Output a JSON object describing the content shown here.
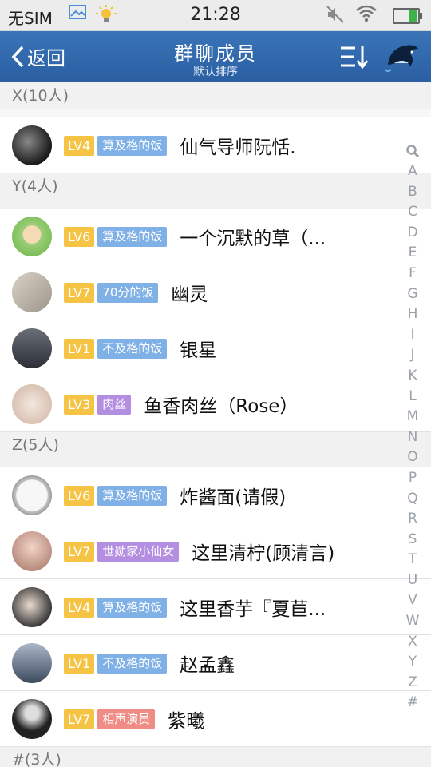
{
  "status_bar": {
    "carrier": "无SIM",
    "time": "21:28"
  },
  "nav": {
    "back_label": "返回",
    "title": "群聊成员",
    "subtitle": "默认排序"
  },
  "sections": [
    {
      "header": "X(10人)",
      "members": [
        {
          "level": "LV4",
          "tag": "算及格的饭",
          "tag_color": "#7fb0e6",
          "name": "仙气导师阮恬."
        }
      ]
    },
    {
      "header": "Y(4人)",
      "members": [
        {
          "level": "LV6",
          "tag": "算及格的饭",
          "tag_color": "#7fb0e6",
          "name": "一个沉默的草（..."
        },
        {
          "level": "LV7",
          "tag": "70分的饭",
          "tag_color": "#7fb0e6",
          "name": "幽灵"
        },
        {
          "level": "LV1",
          "tag": "不及格的饭",
          "tag_color": "#7fb0e6",
          "name": "银星"
        },
        {
          "level": "LV3",
          "tag": "肉丝",
          "tag_color": "#b48ee0",
          "name": "鱼香肉丝（Rose）"
        }
      ]
    },
    {
      "header": "Z(5人)",
      "members": [
        {
          "level": "LV6",
          "tag": "算及格的饭",
          "tag_color": "#7fb0e6",
          "name": "炸酱面(请假)"
        },
        {
          "level": "LV7",
          "tag": "世勋家小仙女",
          "tag_color": "#b48ee0",
          "name": "这里清柠(顾清言)"
        },
        {
          "level": "LV4",
          "tag": "算及格的饭",
          "tag_color": "#7fb0e6",
          "name": "这里香芋『夏苣..."
        },
        {
          "level": "LV1",
          "tag": "不及格的饭",
          "tag_color": "#7fb0e6",
          "name": "赵孟鑫"
        },
        {
          "level": "LV7",
          "tag": "相声演员",
          "tag_color": "#f08c86",
          "name": "紫曦"
        }
      ]
    },
    {
      "header": "#(3人)",
      "members": []
    }
  ],
  "index_letters": [
    "A",
    "B",
    "C",
    "D",
    "E",
    "F",
    "G",
    "H",
    "I",
    "J",
    "K",
    "L",
    "M",
    "N",
    "O",
    "P",
    "Q",
    "R",
    "S",
    "T",
    "U",
    "V",
    "W",
    "X",
    "Y",
    "Z",
    "#"
  ],
  "colors": {
    "nav_bg": "#2f66a9",
    "level_badge": "#f5c445"
  }
}
